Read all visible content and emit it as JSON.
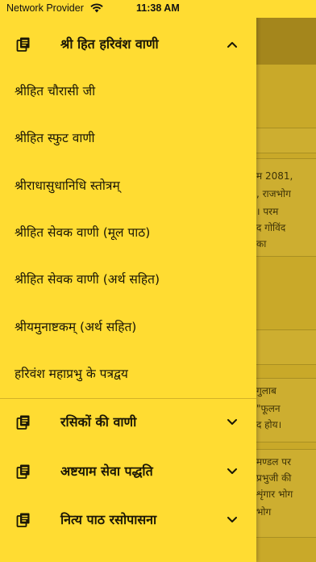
{
  "status_bar": {
    "carrier": "Network Provider",
    "time": "11:38 AM"
  },
  "drawer": {
    "sections": [
      {
        "title": "श्री हित हरिवंश वाणी",
        "expanded": true,
        "icon": "book-icon",
        "items": [
          "श्रीहित चौरासी जी",
          "श्रीहित स्फुट वाणी",
          "श्रीराधासुधानिधि स्तोत्रम्",
          "श्रीहित सेवक वाणी (मूल पाठ)",
          "श्रीहित सेवक वाणी (अर्थ सहित)",
          "श्रीयमुनाष्टकम् (अर्थ सहित)",
          "हरिवंश महाप्रभु के पत्रद्वय"
        ]
      },
      {
        "title": "रसिकों की वाणी",
        "expanded": false,
        "icon": "book-icon"
      },
      {
        "title": "अष्टयाम सेवा पद्धति",
        "expanded": false,
        "icon": "book-icon"
      },
      {
        "title": "नित्य पाठ रसोपासना",
        "expanded": false,
        "icon": "book-icon"
      }
    ]
  },
  "background_page": {
    "lines_block_1": [
      "म 2081,",
      ", राजभोग",
      "। परम",
      "द गोविंद",
      "का"
    ],
    "lines_block_2": [
      "गुलाब",
      "\"फूलन",
      "द होय।"
    ],
    "lines_block_3": [
      "मण्डल पर",
      "प्रभुजी की",
      "शृंगार भोग",
      "भोग"
    ]
  },
  "colors": {
    "drawer_bg": "#ffdc32",
    "overlay_bg": "#c9a929",
    "text": "#1b1706"
  }
}
